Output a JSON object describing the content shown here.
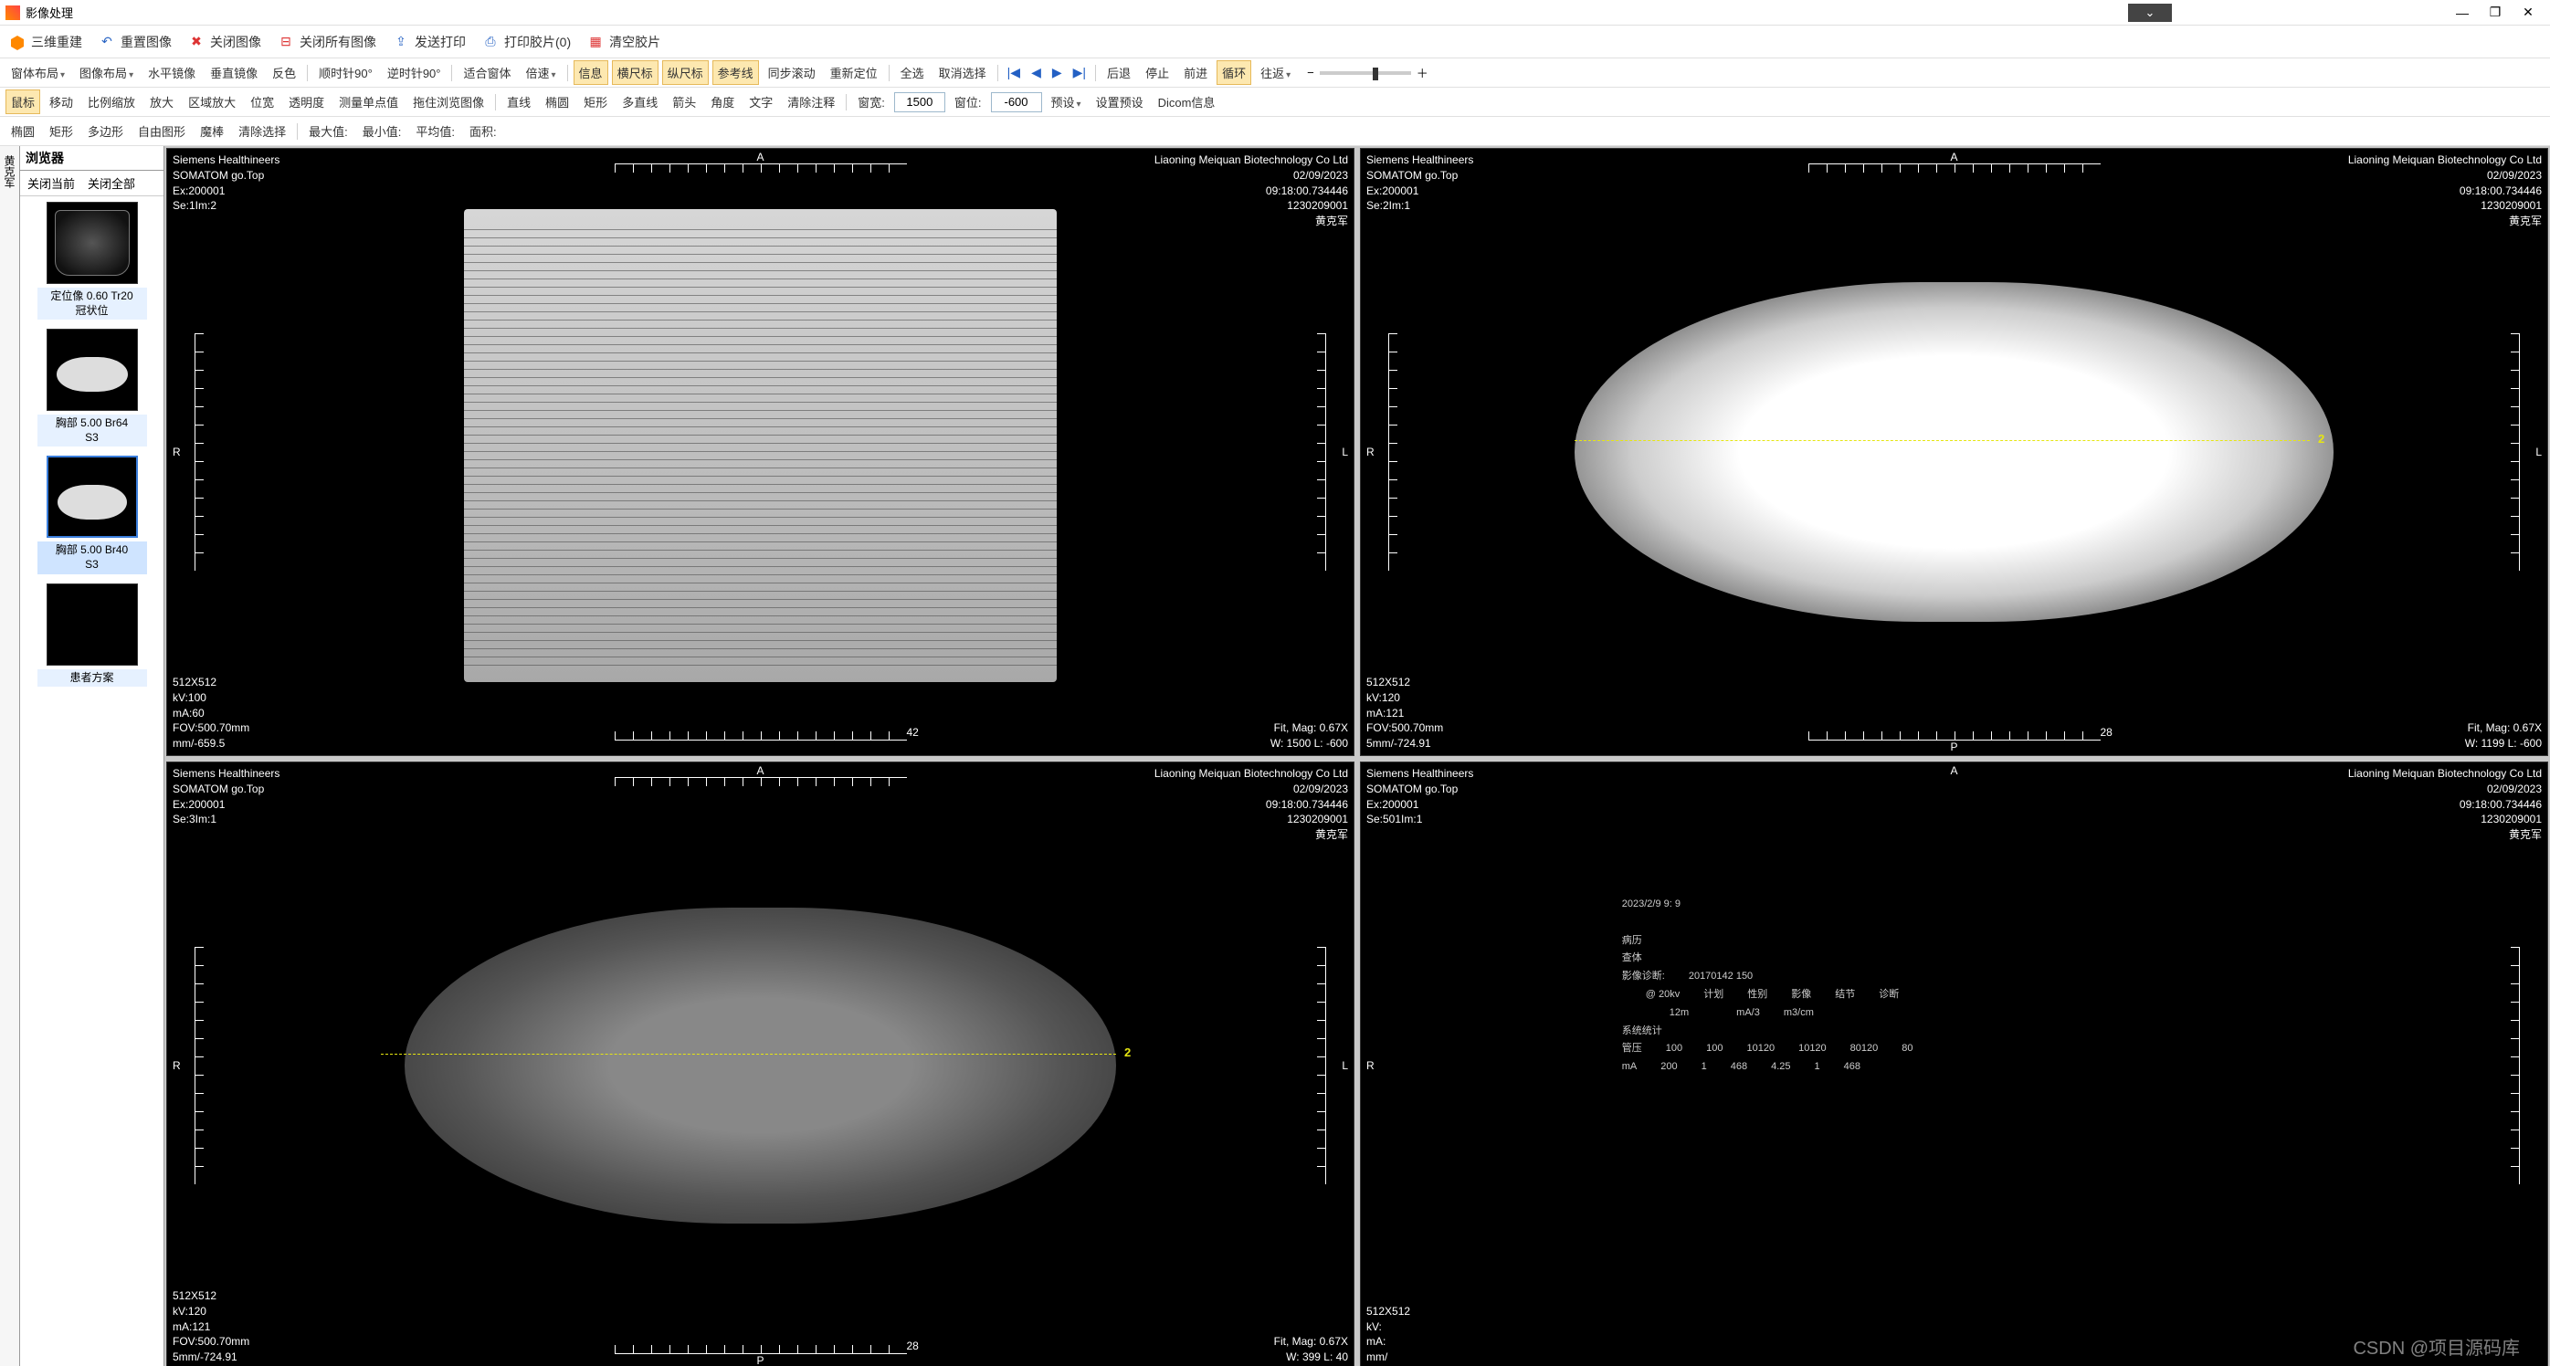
{
  "app": {
    "title": "影像处理"
  },
  "window": {
    "minimize": "—",
    "maximize": "❐",
    "close": "✕"
  },
  "center_dropdown_glyph": "⌄",
  "ribbon": {
    "recon3d": "三维重建",
    "reset_image": "重置图像",
    "close_image": "关闭图像",
    "close_all": "关闭所有图像",
    "send_print": "发送打印",
    "print_film": "打印胶片(0)",
    "clear_film": "清空胶片"
  },
  "toolbar1": {
    "window_layout": "窗体布局",
    "image_layout": "图像布局",
    "flip_h": "水平镜像",
    "flip_v": "垂直镜像",
    "invert": "反色",
    "rotate_cw": "顺时针90°",
    "rotate_ccw": "逆时针90°",
    "fit_window": "适合窗体",
    "speed": "倍速",
    "info": "信息",
    "ruler_h": "横尺标",
    "ruler_v": "纵尺标",
    "refline": "参考线",
    "sync_scroll": "同步滚动",
    "relocate": "重新定位",
    "select_all": "全选",
    "cancel_sel": "取消选择",
    "back": "后退",
    "stop": "停止",
    "forward": "前进",
    "loop": "循环",
    "roundtrip": "往返",
    "nav": {
      "first": "|◀",
      "prev": "◀",
      "next": "▶",
      "last": "▶|"
    },
    "slider": {
      "minus": "−",
      "plus": "＋"
    }
  },
  "toolbar2": {
    "mouse": "鼠标",
    "move": "移动",
    "scale": "比例缩放",
    "zoom": "放大",
    "region_zoom": "区域放大",
    "ww": "位宽",
    "opacity": "透明度",
    "single_point": "测量单点值",
    "drag_browse": "拖住浏览图像",
    "line": "直线",
    "ellipse": "椭圆",
    "rect": "矩形",
    "polyline": "多直线",
    "arrow": "箭头",
    "angle": "角度",
    "text": "文字",
    "clear_anno": "清除注释",
    "ww_label": "窗宽:",
    "ww_value": "1500",
    "wl_label": "窗位:",
    "wl_value": "-600",
    "preset": "预设",
    "preset_config": "设置预设",
    "dicom_info": "Dicom信息"
  },
  "toolbar3": {
    "ellipse": "椭圆",
    "rect": "矩形",
    "polygon": "多边形",
    "freehand": "自由图形",
    "magic": "魔棒",
    "clear_sel": "清除选择",
    "max": "最大值:",
    "min": "最小值:",
    "avg": "平均值:",
    "area": "面积:"
  },
  "browser": {
    "title": "浏览器",
    "close_current": "关闭当前",
    "close_all": "关闭全部",
    "vtab": "黄克军",
    "thumbs": [
      {
        "caption": "定位像 0.60 Tr20\n冠状位"
      },
      {
        "caption": "胸部 5.00 Br64\nS3"
      },
      {
        "caption": "胸部 5.00 Br40\nS3"
      },
      {
        "caption": "患者方案"
      }
    ]
  },
  "marks": {
    "A": "A",
    "P": "P",
    "L": "L",
    "R": "R"
  },
  "vp_common": {
    "mfr": "Siemens Healthineers",
    "model": "SOMATOM go.Top",
    "ex": "Ex:200001",
    "inst": "Liaoning Meiquan Biotechnology Co Ltd",
    "date": "02/09/2023",
    "time": "09:18:00.734446",
    "pid": "1230209001",
    "patient": "黄克军",
    "res": "512X512",
    "mag": "Fit, Mag: 0.67X"
  },
  "vp1": {
    "series": "Se:1Im:2",
    "kv": "kV:100",
    "ma": "mA:60",
    "fov": "FOV:500.70mm",
    "thick": "mm/-659.5",
    "wwl": "W: 1500 L: -600",
    "scale_b": "42"
  },
  "vp2": {
    "series": "Se:2Im:1",
    "kv": "kV:120",
    "ma": "mA:121",
    "fov": "FOV:500.70mm",
    "thick": "5mm/-724.91",
    "wwl": "W: 1199 L: -600",
    "scale_b": "28",
    "refnum": "2"
  },
  "vp3": {
    "series": "Se:3Im:1",
    "kv": "kV:120",
    "ma": "mA:121",
    "fov": "FOV:500.70mm",
    "thick": "5mm/-724.91",
    "wwl": "W: 399 L: 40",
    "scale_b": "28",
    "refnum": "2"
  },
  "vp4": {
    "series": "Se:501Im:1",
    "kv": "kV:",
    "ma": "mA:",
    "fov": "",
    "thick": "mm/",
    "wwl": "",
    "stamp": "2023/2/9 9: 9",
    "rows": [
      [
        "病历"
      ],
      [
        "查体"
      ],
      [
        "影像诊断:",
        "20170142 150"
      ],
      [
        "",
        "@ 20kv",
        "计划",
        "性别",
        "影像",
        "结节",
        "诊断"
      ],
      [
        "",
        "",
        "12m",
        "",
        "mA/3",
        "m3/cm",
        ""
      ],
      [
        "系统统计"
      ],
      [
        "管压",
        "100",
        "100",
        "10120",
        "10120",
        "80120",
        "80"
      ],
      [
        "mA",
        "200",
        "1",
        "468",
        "4.25",
        "1",
        "468"
      ]
    ]
  },
  "watermark": "CSDN @项目源码库"
}
